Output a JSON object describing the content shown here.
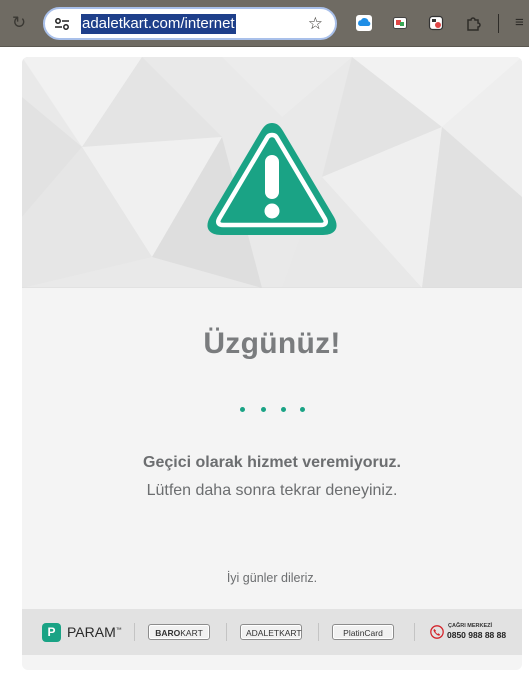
{
  "browser": {
    "url": "adaletkart.com/internet",
    "icons": [
      "reload-icon",
      "site-settings-icon",
      "bookmark-star-icon",
      "cloud-extension-icon",
      "screenshot-extension-icon",
      "extension-icon-3",
      "extensions-puzzle-icon",
      "menu-icon"
    ]
  },
  "page": {
    "title": "Üzgünüz!",
    "message_primary": "Geçici olarak hizmet veremiyoruz.",
    "message_secondary": "Lütfen daha sonra tekrar deneyiniz.",
    "closing": "İyi günler dileriz."
  },
  "footer": {
    "param_badge": "P",
    "param_name": "PARAM",
    "param_tm": "™",
    "logos": [
      {
        "bold": "BARO",
        "rest": "KART"
      },
      {
        "bold": "",
        "rest": "ADALETKART"
      },
      {
        "bold": "",
        "rest": "PlatinCard"
      }
    ],
    "call_center_label": "ÇAĞRI MERKEZİ",
    "call_center_number": "0850 988 88 88"
  },
  "colors": {
    "accent": "#1aa385",
    "text_gray": "#6c6e70",
    "title_gray": "#7a7c7e",
    "toolbar": "#6f6b63",
    "url_highlight": "#1e3f8a"
  }
}
